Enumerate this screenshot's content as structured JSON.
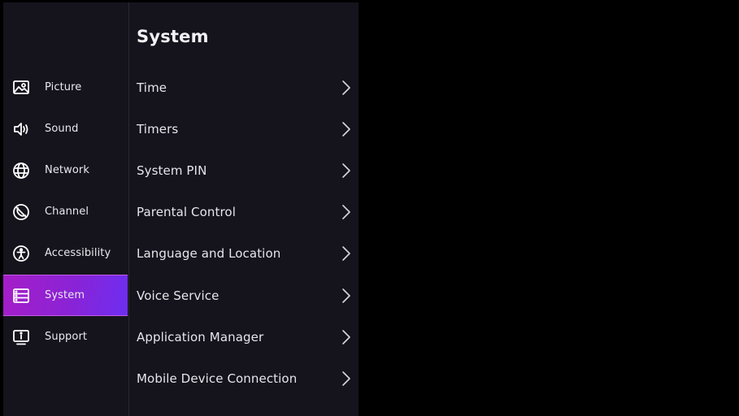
{
  "sidebar": {
    "items": [
      {
        "label": "Picture",
        "icon": "picture-icon"
      },
      {
        "label": "Sound",
        "icon": "speaker-icon"
      },
      {
        "label": "Network",
        "icon": "globe-icon"
      },
      {
        "label": "Channel",
        "icon": "channel-icon"
      },
      {
        "label": "Accessibility",
        "icon": "accessibility-icon"
      },
      {
        "label": "System",
        "icon": "system-icon",
        "selected": true
      },
      {
        "label": "Support",
        "icon": "support-icon"
      }
    ]
  },
  "panel": {
    "title": "System",
    "items": [
      {
        "label": "Time"
      },
      {
        "label": "Timers"
      },
      {
        "label": "System PIN"
      },
      {
        "label": "Parental Control"
      },
      {
        "label": "Language and Location"
      },
      {
        "label": "Voice Service"
      },
      {
        "label": "Application Manager"
      },
      {
        "label": "Mobile Device Connection"
      }
    ]
  },
  "colors": {
    "background": "#000000",
    "panel_bg": "#15141d",
    "accent_start": "#a51ec7",
    "accent_end": "#6d2ef0",
    "text": "#e9e8ee"
  }
}
